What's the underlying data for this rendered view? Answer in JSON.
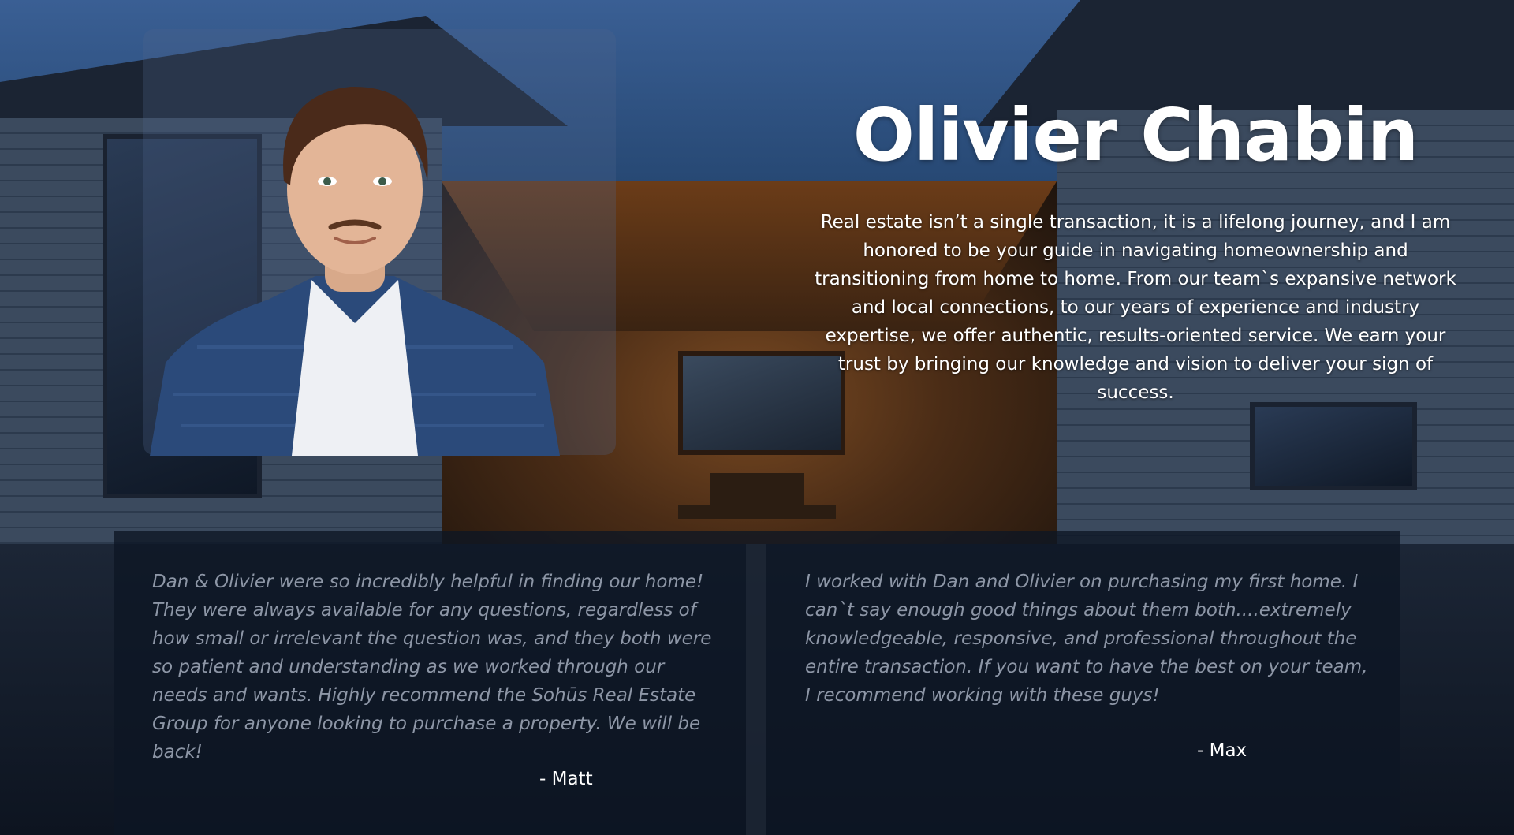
{
  "agent": {
    "name": "Olivier Chabin",
    "bio": "Real estate isn’t a single transaction, it is a lifelong journey, and I am honored to be your guide in navigating homeownership and transitioning from home to home. From our team`s expansive network and local connections, to our years of experience and industry expertise, we offer authentic, results-oriented service. We earn your trust by bringing our knowledge and vision to deliver your sign of success."
  },
  "testimonials": [
    {
      "quote": "Dan & Olivier were so incredibly helpful in finding our home! They were always available for any questions, regardless of how small or irrelevant the question was, and they both were so patient and understanding as we worked through our needs and wants. Highly recommend the Sohūs Real Estate Group for anyone looking to purchase a property. We will be back!",
      "author": "- Matt"
    },
    {
      "quote": "I worked with Dan and Olivier on purchasing my first home. I can`t say enough good things about them both....extremely knowledgeable, responsive, and professional throughout the entire transaction. If you want to have the best on your team, I recommend working with these guys!",
      "author": "- Max"
    }
  ],
  "colors": {
    "heading_text": "#ffffff",
    "quote_text": "#8d96a6",
    "panel_overlay": "#0d1624"
  }
}
